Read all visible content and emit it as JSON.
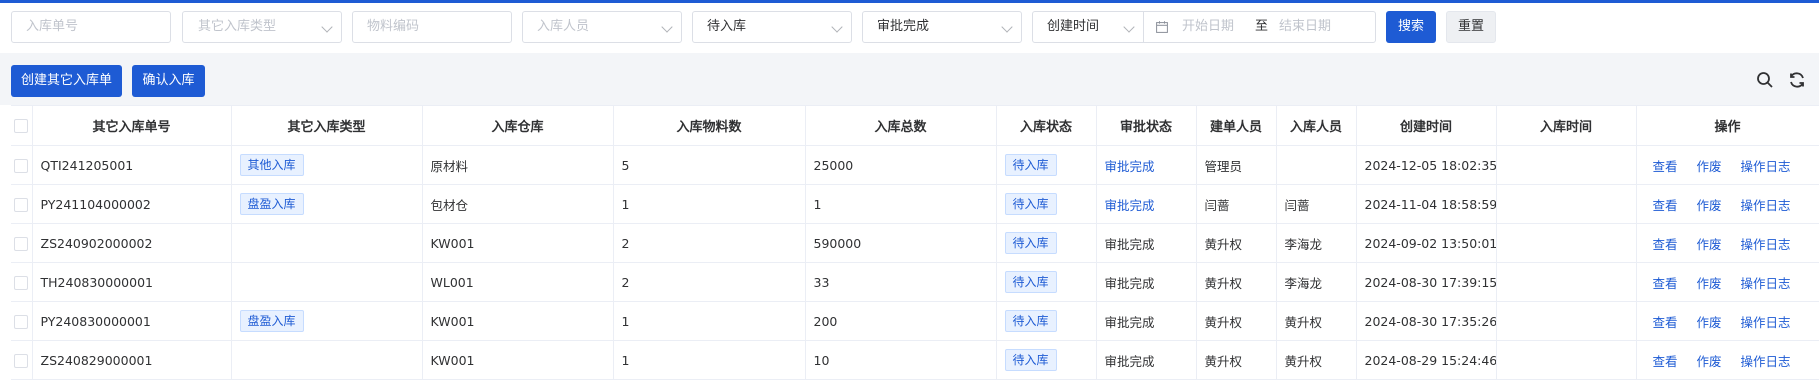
{
  "filters": {
    "order_no_placeholder": "入库单号",
    "other_type_placeholder": "其它入库类型",
    "material_code_placeholder": "物料编码",
    "operator_placeholder": "入库人员",
    "status_value": "待入库",
    "approval_value": "审批完成",
    "date_field_value": "创建时间",
    "start_date_placeholder": "开始日期",
    "range_sep": "至",
    "end_date_placeholder": "结束日期",
    "search_label": "搜索",
    "reset_label": "重置"
  },
  "toolbar": {
    "create_label": "创建其它入库单",
    "confirm_label": "确认入库"
  },
  "table": {
    "headers": [
      "其它入库单号",
      "其它入库类型",
      "入库仓库",
      "入库物料数",
      "入库总数",
      "入库状态",
      "审批状态",
      "建单人员",
      "入库人员",
      "创建时间",
      "入库时间",
      "操作"
    ],
    "actions": [
      "查看",
      "作废",
      "操作日志"
    ],
    "rows": [
      {
        "no": "QTI241205001",
        "type": "其他入库",
        "warehouse": "原材料",
        "materials": "5",
        "total": "25000",
        "status": "待入库",
        "approval": "审批完成",
        "creator": "管理员",
        "operator": "",
        "created": "2024-12-05 18:02:35",
        "in_time": ""
      },
      {
        "no": "PY241104000002",
        "type": "盘盈入库",
        "warehouse": "包材仓",
        "materials": "1",
        "total": "1",
        "status": "待入库",
        "approval": "审批完成",
        "creator": "闫蔷",
        "operator": "闫蔷",
        "created": "2024-11-04 18:58:59",
        "in_time": ""
      },
      {
        "no": "ZS240902000002",
        "type": "",
        "warehouse": "KW001",
        "materials": "2",
        "total": "590000",
        "status": "待入库",
        "approval": "审批完成",
        "creator": "黄升权",
        "operator": "李海龙",
        "created": "2024-09-02 13:50:01",
        "in_time": ""
      },
      {
        "no": "TH240830000001",
        "type": "",
        "warehouse": "WL001",
        "materials": "2",
        "total": "33",
        "status": "待入库",
        "approval": "审批完成",
        "creator": "黄升权",
        "operator": "李海龙",
        "created": "2024-08-30 17:39:15",
        "in_time": ""
      },
      {
        "no": "PY240830000001",
        "type": "盘盈入库",
        "warehouse": "KW001",
        "materials": "1",
        "total": "200",
        "status": "待入库",
        "approval": "审批完成",
        "creator": "黄升权",
        "operator": "黄升权",
        "created": "2024-08-30 17:35:26",
        "in_time": ""
      },
      {
        "no": "ZS240829000001",
        "type": "",
        "warehouse": "KW001",
        "materials": "1",
        "total": "10",
        "status": "待入库",
        "approval": "审批完成",
        "creator": "黄升权",
        "operator": "黄升权",
        "created": "2024-08-29 15:24:46",
        "in_time": ""
      }
    ]
  },
  "colors": {
    "primary": "#1e5bd4",
    "tag_bg": "#e8f1ff",
    "toolbar_bg": "#f3f5f8"
  },
  "icons": {
    "search": "search-icon",
    "refresh": "refresh-icon",
    "calendar": "calendar-icon",
    "chevron": "chevron-down-icon"
  }
}
